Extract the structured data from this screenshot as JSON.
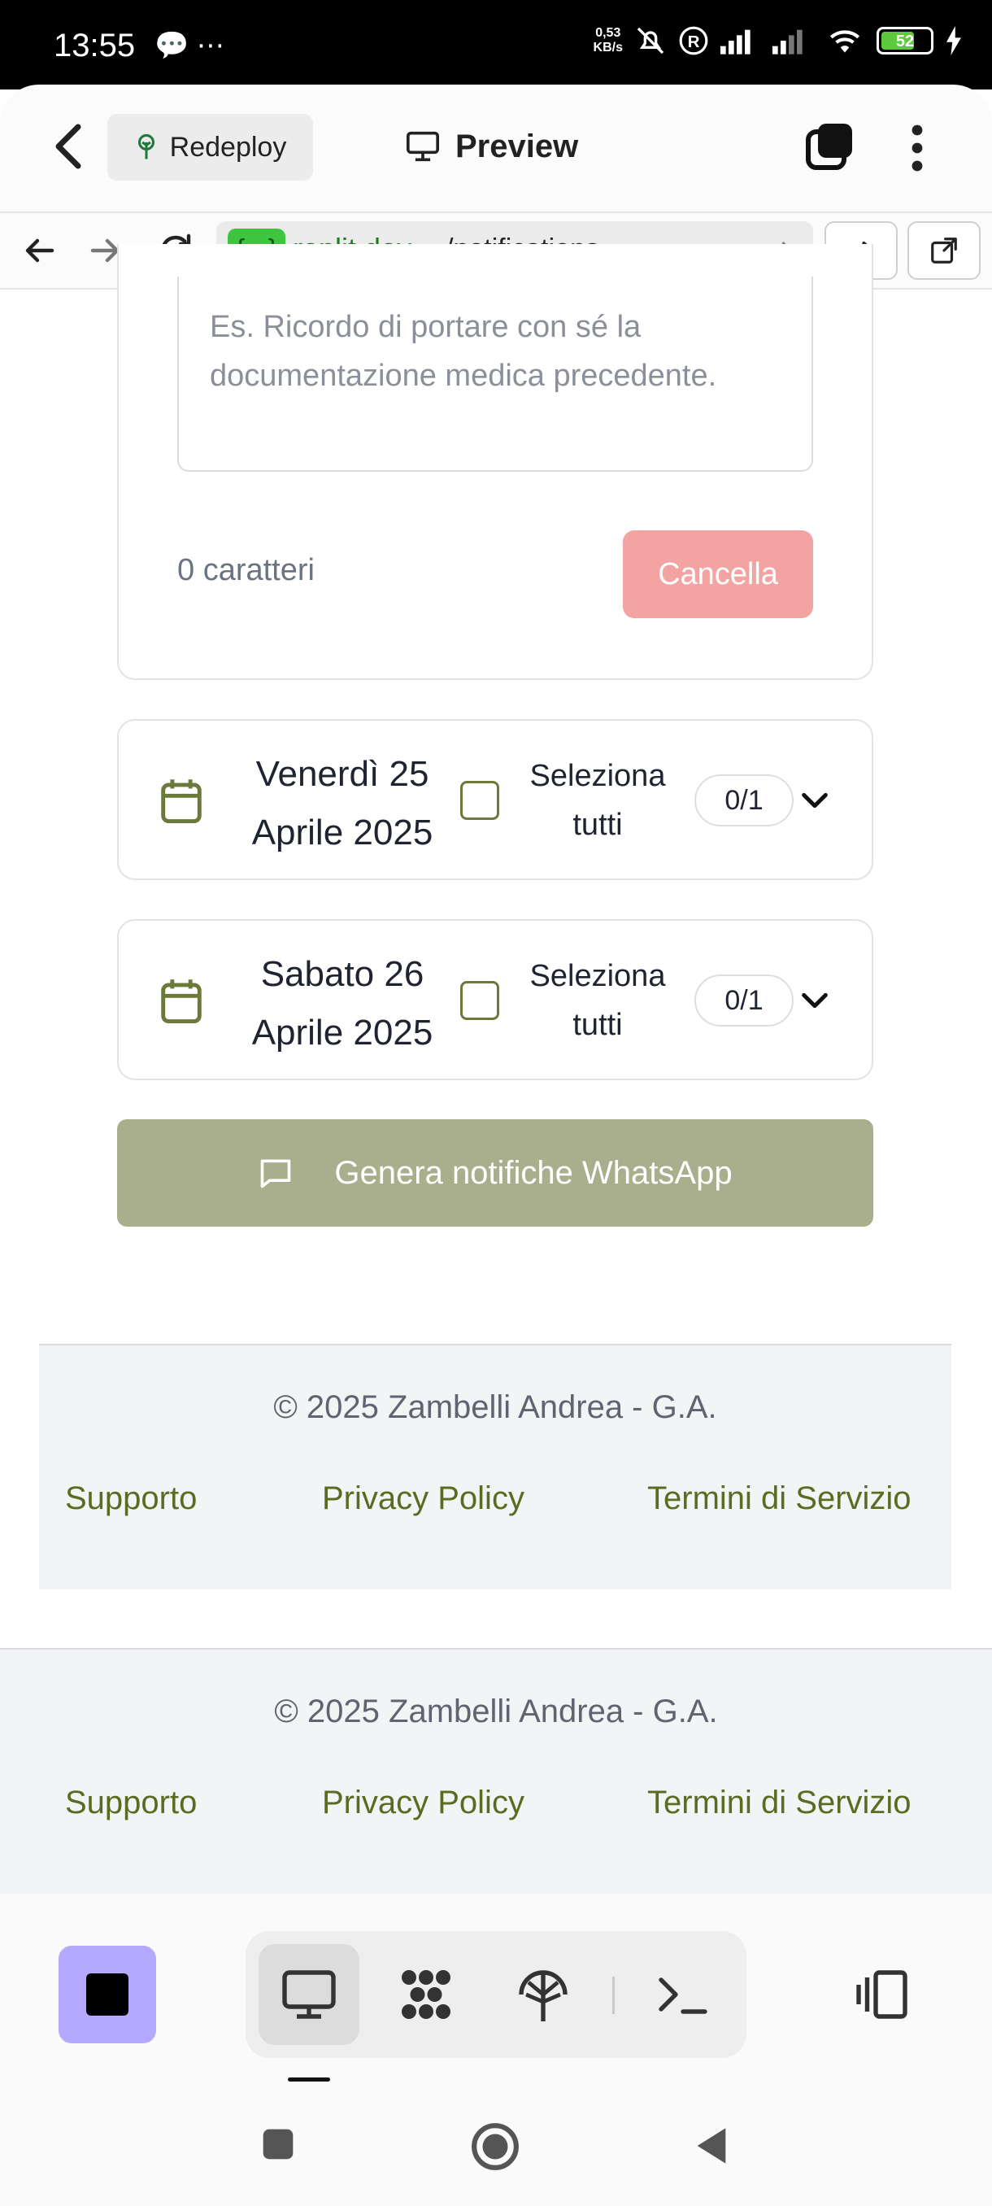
{
  "status_bar": {
    "time": "13:55",
    "speed_value": "0,53",
    "speed_unit": "KB/s",
    "battery": "52"
  },
  "header": {
    "redeploy_label": "Redeploy",
    "title": "Preview"
  },
  "urlbar": {
    "tag": "{...}",
    "host": ".replit.dev",
    "path": "/notifications"
  },
  "form": {
    "placeholder": "Es. Ricordo di portare con sé la documentazione medica precedente.",
    "char_count": "0 caratteri",
    "cancel_label": "Cancella"
  },
  "days": [
    {
      "date_line1": "Venerdì 25",
      "date_line2": "Aprile 2025",
      "select_line1": "Seleziona",
      "select_line2": "tutti",
      "count": "0/1"
    },
    {
      "date_line1": "Sabato 26",
      "date_line2": "Aprile 2025",
      "select_line1": "Seleziona",
      "select_line2": "tutti",
      "count": "0/1"
    }
  ],
  "generate_label": "Genera notifiche WhatsApp",
  "footer": {
    "copyright": "© 2025 Zambelli Andrea - G.A.",
    "links": [
      "Supporto",
      "Privacy Policy",
      "Termini di Servizio"
    ]
  },
  "colors": {
    "accent_olive": "#5c6b22",
    "whatsapp_button": "#a9ae8c",
    "cancel_button": "#f4a3a3",
    "stop_button": "#b4a8ff"
  }
}
